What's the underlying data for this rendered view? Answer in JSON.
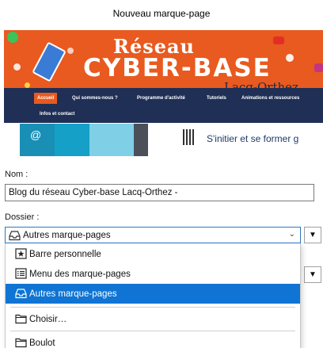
{
  "dialog": {
    "title": "Nouveau marque-page"
  },
  "preview": {
    "logo_line1": "Réseau",
    "logo_line2": "CYBER-BASE",
    "logo_line3": "Lacq-Orthez",
    "nav_items": [
      "Accueil",
      "Qui sommes-nous ?",
      "Programme d'activité",
      "Tutoriels",
      "Animations et ressources",
      "Infos et contact"
    ],
    "teaser": "S'initier et se former g",
    "colors": {
      "banner": "#e85a1f",
      "nav": "#1f2f55"
    }
  },
  "form": {
    "name_label": "Nom :",
    "name_value": "Blog du réseau Cyber-base Lacq-Orthez -",
    "folder_label": "Dossier :",
    "folder_value": "Autres marque-pages",
    "folder_icon": "bookmarks-tray-icon"
  },
  "dropdown": {
    "items": [
      {
        "label": "Barre personnelle",
        "icon": "star-toolbar-icon"
      },
      {
        "label": "Menu des marque-pages",
        "icon": "menu-list-icon"
      },
      {
        "label": "Autres marque-pages",
        "icon": "bookmarks-tray-icon",
        "selected": true
      },
      {
        "label": "Choisir…",
        "icon": "folder-icon"
      },
      {
        "label": "Boulot",
        "icon": "folder-icon"
      }
    ],
    "accent_color": "#0f74d3"
  }
}
